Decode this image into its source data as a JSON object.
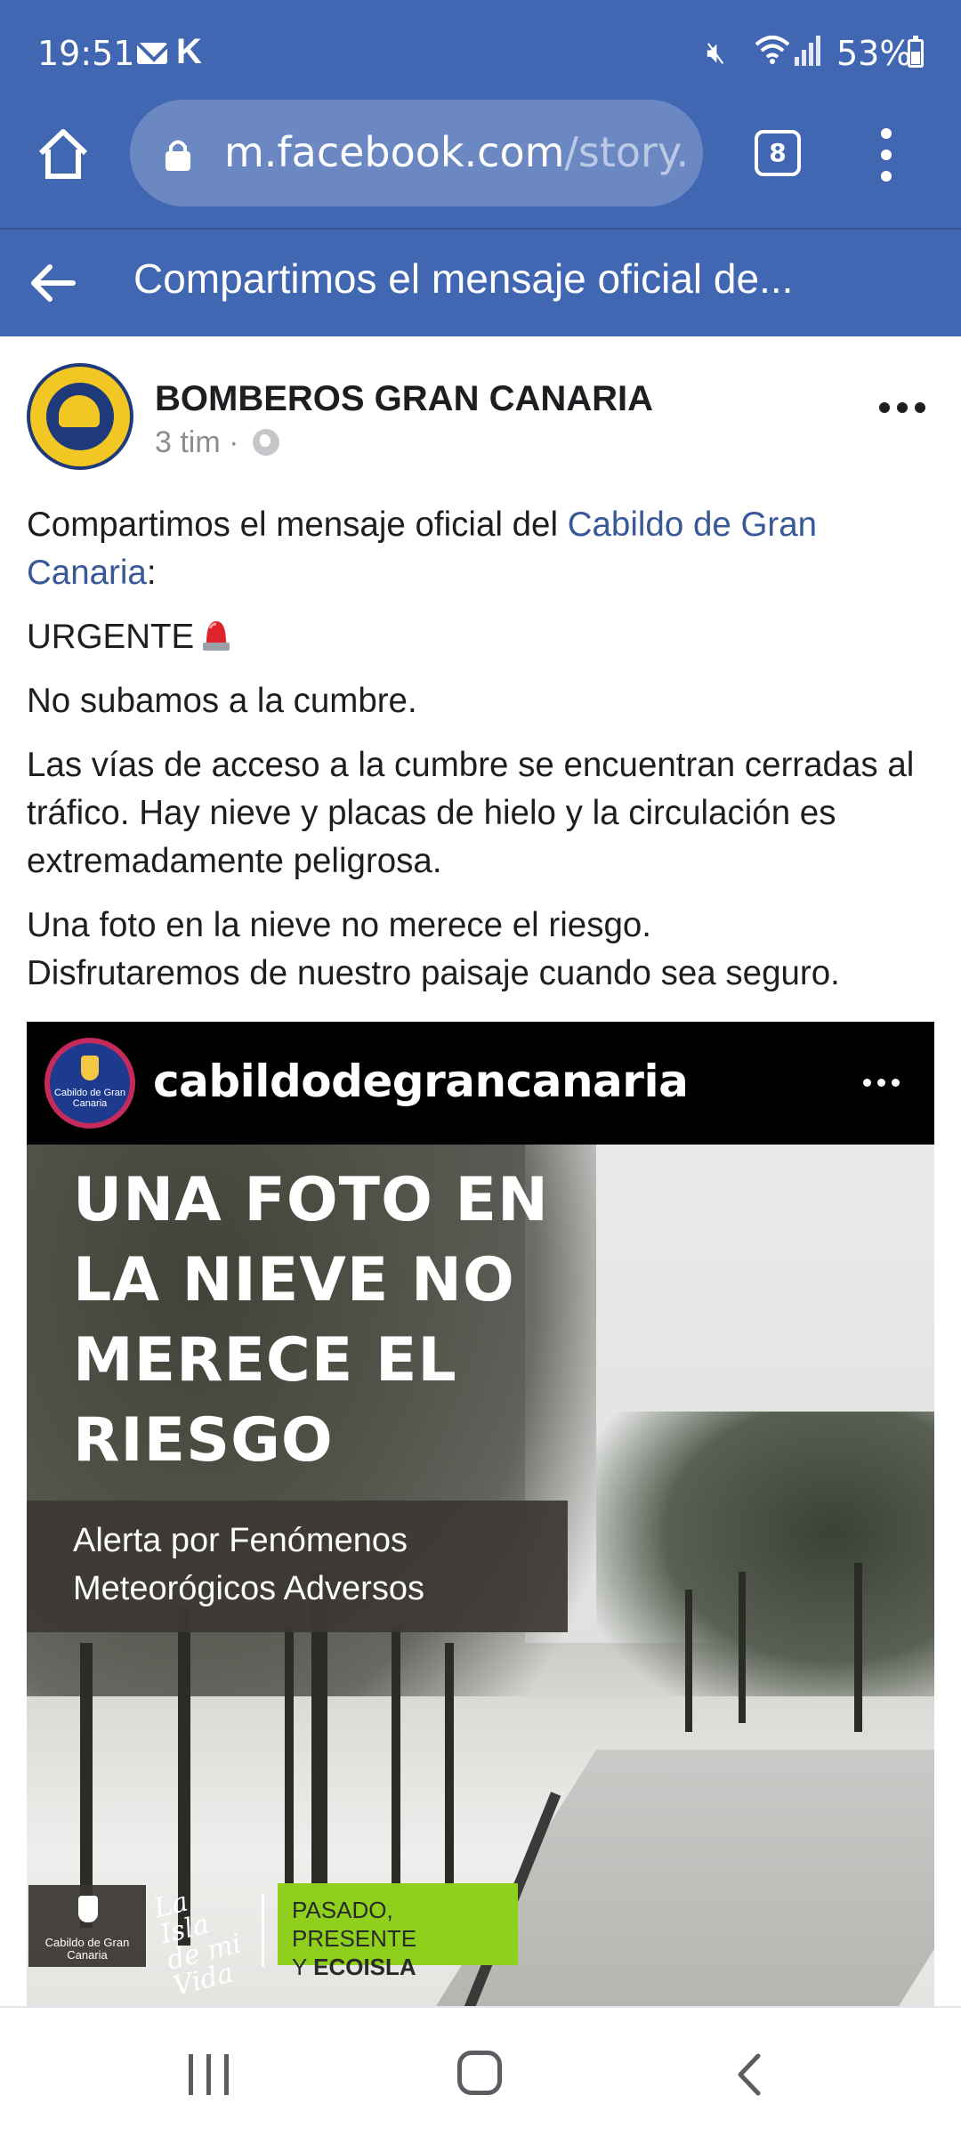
{
  "status_bar": {
    "time": "19:51",
    "carrier_glyph": "K",
    "battery": "53%"
  },
  "browser": {
    "url_host": "m.facebook.com",
    "url_path": "/story.p",
    "tab_count": "8"
  },
  "page": {
    "title": "Compartimos el mensaje oficial de..."
  },
  "post": {
    "author": "BOMBEROS GRAN CANARIA",
    "time_ago": "3 tim",
    "meta_separator": "·",
    "text_intro": "Compartimos el mensaje oficial del ",
    "text_link": "Cabildo de Gran Canaria",
    "text_colon": ":",
    "urgent": "URGENTE",
    "line_2": "No subamos a la cumbre.",
    "line_3": "Las vías de acceso a la cumbre se encuentran cerradas al tráfico. Hay nieve y placas de hielo y la circulación es extremadamente peligrosa.",
    "line_4": "Una foto en la nieve no merece el riesgo.",
    "line_5": "Disfrutaremos de nuestro paisaje cuando sea seguro."
  },
  "media": {
    "ig_account": "cabildodegrancanaria",
    "ig_avatar_text": "Cabildo de Gran Canaria",
    "headline": "UNA FOTO EN LA NIEVE NO MERECE EL RIESGO",
    "alert_line_1": "Alerta por Fenómenos",
    "alert_line_2": "Meteorógicos Adversos",
    "footer_logo_text": "Cabildo de Gran Canaria",
    "script_logo": "La Isla de mi Vida",
    "green_line_1": "PASADO, PRESENTE",
    "green_line_2_prefix": "Y ",
    "green_line_2_bold": "ECOISLA"
  },
  "colors": {
    "facebook_blue": "#4267b2",
    "link": "#385898",
    "eco_green": "#8ed01c"
  },
  "icons": [
    "home-icon",
    "lock-icon",
    "tabs-icon",
    "menu-icon",
    "back-arrow-icon",
    "globe-icon",
    "more-icon",
    "siren-icon",
    "recents-icon",
    "nav-home-icon",
    "nav-back-icon"
  ]
}
